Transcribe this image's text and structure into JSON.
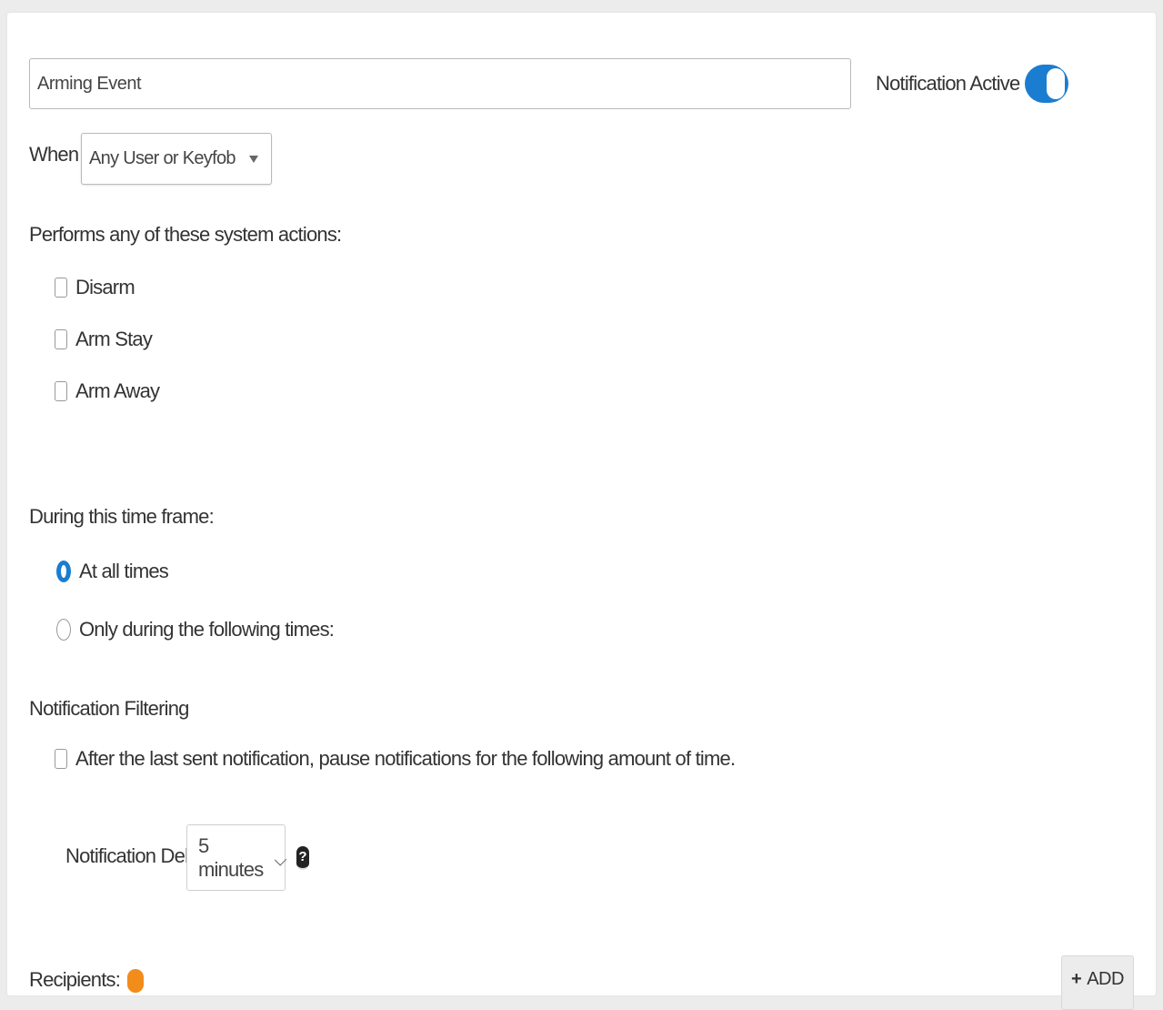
{
  "form": {
    "event_name": "Arming Event",
    "notification_active_label": "Notification Active",
    "notification_active": true,
    "when_label": "When",
    "when_value": "Any User or Keyfob",
    "actions_heading": "Performs any of these system actions:",
    "actions": [
      {
        "label": "Disarm",
        "checked": false
      },
      {
        "label": "Arm Stay",
        "checked": false
      },
      {
        "label": "Arm Away",
        "checked": false
      }
    ],
    "time_frame_heading": "During this time frame:",
    "time_options": [
      {
        "label": "At all times",
        "selected": true
      },
      {
        "label": "Only during the following times:",
        "selected": false
      }
    ],
    "filtering_heading": "Notification Filtering",
    "filtering_option": "After the last sent notification, pause notifications for the following amount of time.",
    "delay_label": "Notification Delay:",
    "delay_value": "5 minutes",
    "help_icon": "?",
    "recipients_label": "Recipients:",
    "add_button_label": "ADD",
    "add_icon": "+"
  },
  "colors": {
    "accent": "#1b7dd0",
    "warning": "#f28c1a"
  }
}
